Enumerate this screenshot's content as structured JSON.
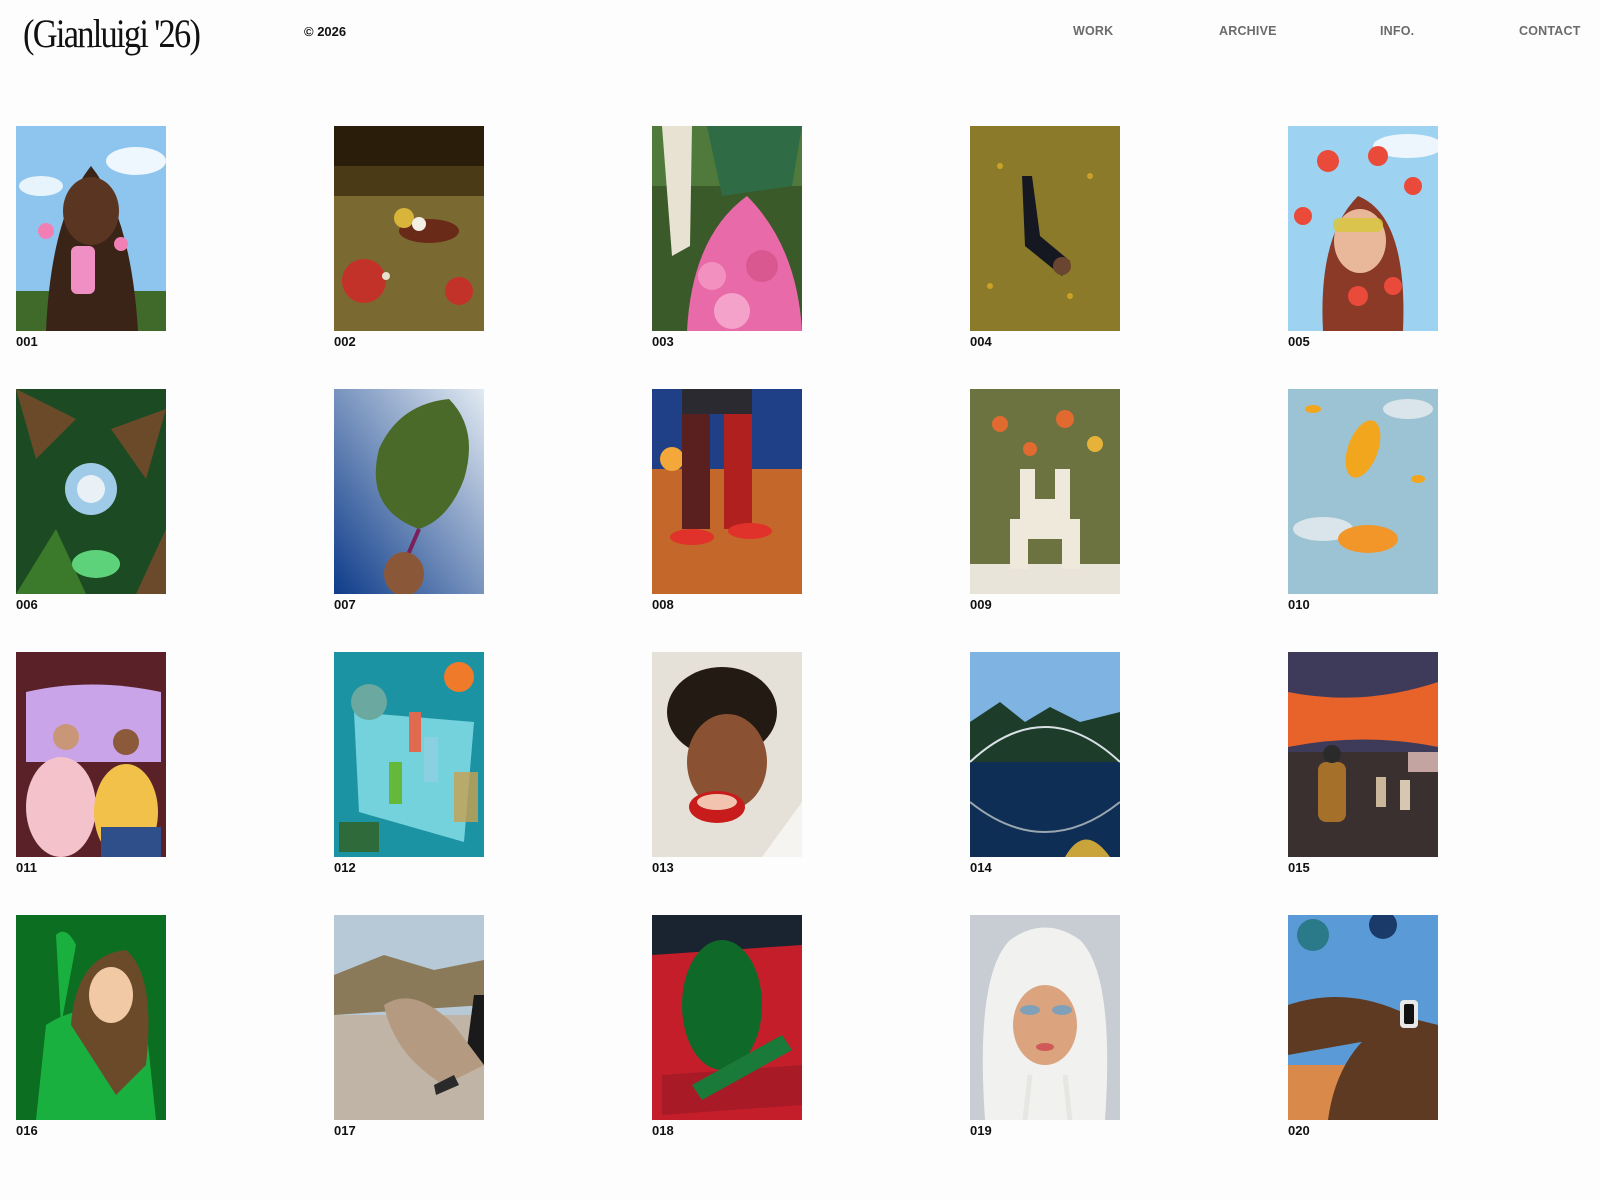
{
  "header": {
    "logo": "(Gianluigi '26)",
    "copyright": "© 2026",
    "nav": [
      "WORK",
      "ARCHIVE",
      "INFO.",
      "CONTACT"
    ]
  },
  "tiles": [
    {
      "label": "001",
      "scene": "portrait-sky",
      "colors": [
        "#8ec5ef",
        "#3a2418",
        "#ef8fc4"
      ]
    },
    {
      "label": "002",
      "scene": "table",
      "colors": [
        "#4a3a16",
        "#7a6a32",
        "#c33228"
      ]
    },
    {
      "label": "003",
      "scene": "flowers-field",
      "colors": [
        "#3a5a2a",
        "#e86aa8",
        "#2f6b45"
      ]
    },
    {
      "label": "004",
      "scene": "lying-field",
      "colors": [
        "#8a7a2a",
        "#c9a227",
        "#151820"
      ]
    },
    {
      "label": "005",
      "scene": "tulips-sky",
      "colors": [
        "#9ed2f1",
        "#e94a3a",
        "#8a3a26"
      ]
    },
    {
      "label": "006",
      "scene": "foliage",
      "colors": [
        "#1c4a22",
        "#6b4a2a",
        "#5ed27a"
      ]
    },
    {
      "label": "007",
      "scene": "kale-blue",
      "colors": [
        "#0e3c8a",
        "#e2eaf2",
        "#4a6a2a"
      ]
    },
    {
      "label": "008",
      "scene": "legs-desert",
      "colors": [
        "#1f3f86",
        "#c4672a",
        "#e0322a"
      ]
    },
    {
      "label": "009",
      "scene": "vase",
      "colors": [
        "#6d7340",
        "#efe9dc",
        "#e06a30"
      ]
    },
    {
      "label": "010",
      "scene": "clogs-sky",
      "colors": [
        "#9cc3d3",
        "#f2a61e",
        "#e9eef0"
      ]
    },
    {
      "label": "011",
      "scene": "two-women",
      "colors": [
        "#5a2128",
        "#c9a4e8",
        "#f4c2cb"
      ]
    },
    {
      "label": "012",
      "scene": "nail-polish",
      "colors": [
        "#1c93a3",
        "#73d2dc",
        "#2f6a3a"
      ]
    },
    {
      "label": "013",
      "scene": "smile-fruit",
      "colors": [
        "#e6e1d8",
        "#231a14",
        "#c81c1c"
      ]
    },
    {
      "label": "014",
      "scene": "lake-bridge",
      "colors": [
        "#7fb4e2",
        "#1d3d2a",
        "#0e2e55"
      ]
    },
    {
      "label": "015",
      "scene": "sunset",
      "colors": [
        "#3d3a5a",
        "#e8632a",
        "#3a3030"
      ]
    },
    {
      "label": "016",
      "scene": "green-sweater",
      "colors": [
        "#0b6e20",
        "#19b040",
        "#6b4a2a"
      ]
    },
    {
      "label": "017",
      "scene": "boot-road",
      "colors": [
        "#b7c8d6",
        "#8a7a5a",
        "#c0b4a6"
      ]
    },
    {
      "label": "018",
      "scene": "chair",
      "colors": [
        "#1a2430",
        "#c41e2a",
        "#0f6a2a"
      ]
    },
    {
      "label": "019",
      "scene": "balaclava",
      "colors": [
        "#c7cdd2",
        "#f1f1ef",
        "#dba47e"
      ]
    },
    {
      "label": "020",
      "scene": "watch",
      "colors": [
        "#5a9ad6",
        "#5e3a22",
        "#d6a46e"
      ]
    }
  ]
}
